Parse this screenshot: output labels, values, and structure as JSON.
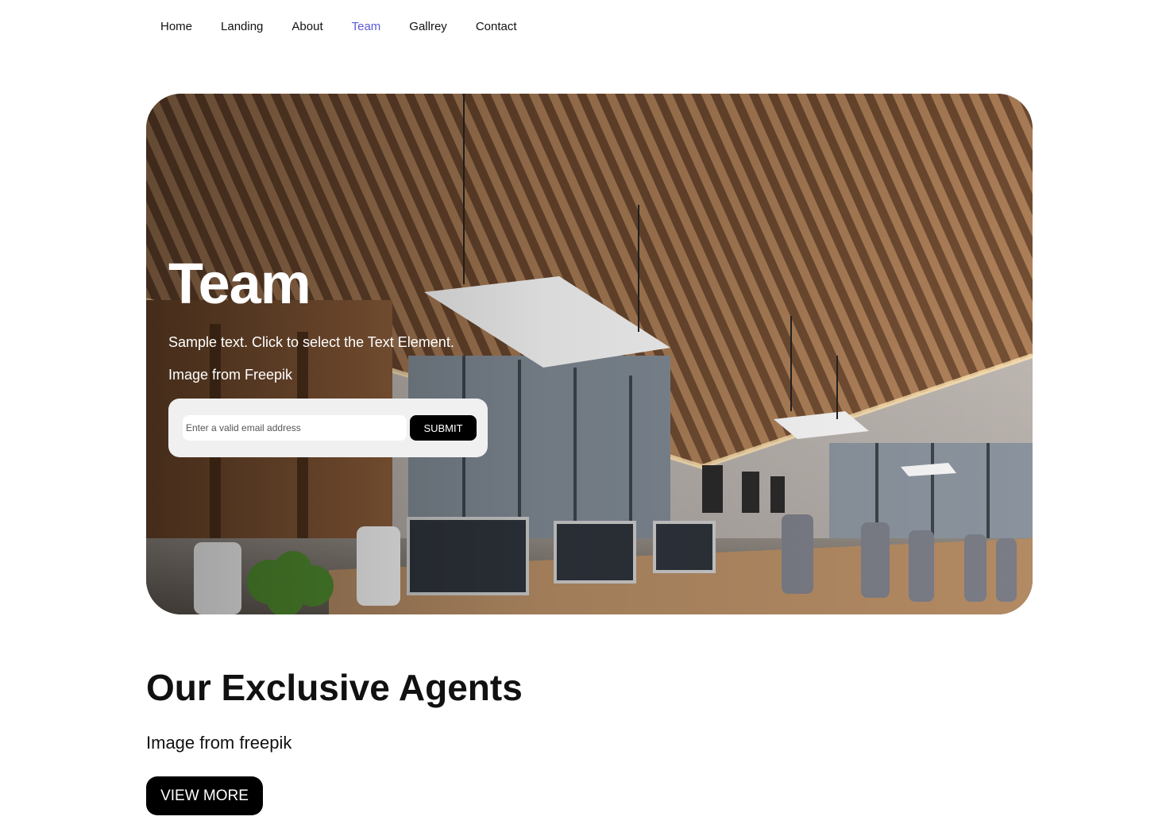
{
  "nav": {
    "items": [
      {
        "label": "Home"
      },
      {
        "label": "Landing"
      },
      {
        "label": "About"
      },
      {
        "label": "Team"
      },
      {
        "label": "Gallrey"
      },
      {
        "label": "Contact"
      }
    ],
    "active_color": "#5b5bd6"
  },
  "hero": {
    "title": "Team",
    "text1": "Sample text. Click to select the Text Element.",
    "text2": "Image from Freepik",
    "email_placeholder": "Enter a valid email address",
    "submit_label": "SUBMIT",
    "image_icon": "office-conference-room-photo"
  },
  "agents": {
    "title": "Our Exclusive Agents",
    "text": "Image from freepik",
    "button_label": "VIEW MORE"
  }
}
